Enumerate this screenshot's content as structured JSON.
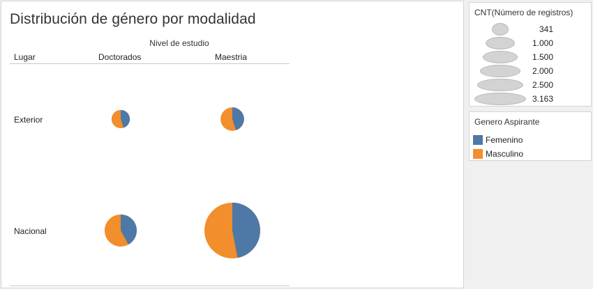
{
  "chart_data": {
    "type": "pie",
    "title": "Distribución de género por modalidad",
    "column_group_label": "Nivel de estudio",
    "row_group_label": "Lugar",
    "columns": [
      "Doctorados",
      "Maestria"
    ],
    "rows": [
      "Exterior",
      "Nacional"
    ],
    "series": [
      {
        "name": "Femenino",
        "color": "#4e79a7"
      },
      {
        "name": "Masculino",
        "color": "#f28e2b"
      }
    ],
    "cells": [
      {
        "row": "Exterior",
        "column": "Doctorados",
        "count": 341,
        "femenino_share": 0.45
      },
      {
        "row": "Exterior",
        "column": "Maestria",
        "count": 560,
        "femenino_share": 0.45
      },
      {
        "row": "Nacional",
        "column": "Doctorados",
        "count": 1050,
        "femenino_share": 0.42
      },
      {
        "row": "Nacional",
        "column": "Maestria",
        "count": 3163,
        "femenino_share": 0.47
      }
    ]
  },
  "size_legend": {
    "title": "CNT(Número de registros)",
    "items": [
      {
        "value": 341,
        "label": "341"
      },
      {
        "value": 1000,
        "label": "1.000"
      },
      {
        "value": 1500,
        "label": "1.500"
      },
      {
        "value": 2000,
        "label": "2.000"
      },
      {
        "value": 2500,
        "label": "2.500"
      },
      {
        "value": 3163,
        "label": "3.163"
      }
    ]
  },
  "color_legend": {
    "title": "Genero Aspirante",
    "items": [
      {
        "label": "Femenino",
        "color": "#4e79a7"
      },
      {
        "label": "Masculino",
        "color": "#f28e2b"
      }
    ]
  }
}
